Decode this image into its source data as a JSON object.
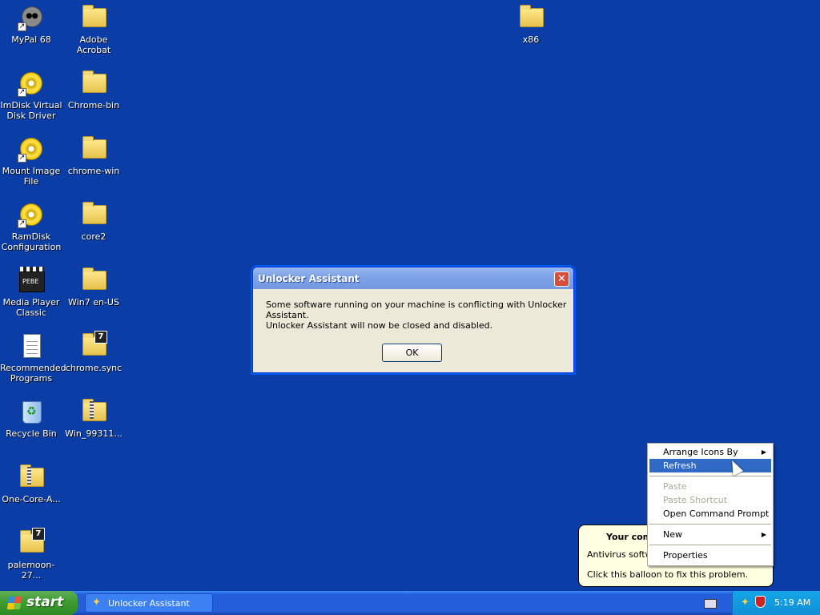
{
  "desktop": {
    "icons": [
      {
        "label": "MyPal 68"
      },
      {
        "label": "Adobe Acrobat"
      },
      {
        "label": "x86"
      },
      {
        "label": "ImDisk Virtual Disk Driver"
      },
      {
        "label": "Chrome-bin"
      },
      {
        "label": "Mount Image File"
      },
      {
        "label": "chrome-win"
      },
      {
        "label": "RamDisk Configuration"
      },
      {
        "label": "core2"
      },
      {
        "label": "Media Player Classic"
      },
      {
        "label": "Win7 en-US"
      },
      {
        "label": "Recommended Programs"
      },
      {
        "label": "chrome.sync"
      },
      {
        "label": "Recycle Bin"
      },
      {
        "label": "Win_99311..."
      },
      {
        "label": "One-Core-A..."
      },
      {
        "label": "palemoon-27..."
      }
    ]
  },
  "dialog": {
    "title": "Unlocker Assistant",
    "close_symbol": "✕",
    "message_1": "Some software running on your machine is conflicting with Unlocker Assistant.",
    "message_2": "Unlocker Assistant will now be closed and disabled.",
    "ok_label": "OK"
  },
  "balloon": {
    "title": "Your com",
    "line1": "Antivirus softwa",
    "line2": "Click this balloon to fix this problem."
  },
  "context_menu": {
    "items": [
      {
        "label": "Arrange Icons By"
      },
      {
        "label": "Refresh"
      },
      {
        "label": "Paste"
      },
      {
        "label": "Paste Shortcut"
      },
      {
        "label": "Open Command Prompt"
      },
      {
        "label": "New"
      },
      {
        "label": "Properties"
      }
    ],
    "submenu_arrow": "▶"
  },
  "taskbar": {
    "start_label": "start",
    "task_label": "Unlocker Assistant",
    "clock": "5:19 AM"
  },
  "icon_names": [
    "folder-icon",
    "disc-icon",
    "clapperboard-icon",
    "document-icon",
    "recycle-bin-icon",
    "zip-folder-icon",
    "7zip-archive-icon",
    "wand-icon",
    "shield-icon",
    "keyboard-icon",
    "windows-flag-icon",
    "cursor-icon"
  ],
  "colors": {
    "desktop": "#0a3ea6",
    "taskbar": "#245edb",
    "start": "#3c9b2e",
    "menu_highlight": "#316ac5",
    "dialog_bg": "#ece9d8"
  }
}
